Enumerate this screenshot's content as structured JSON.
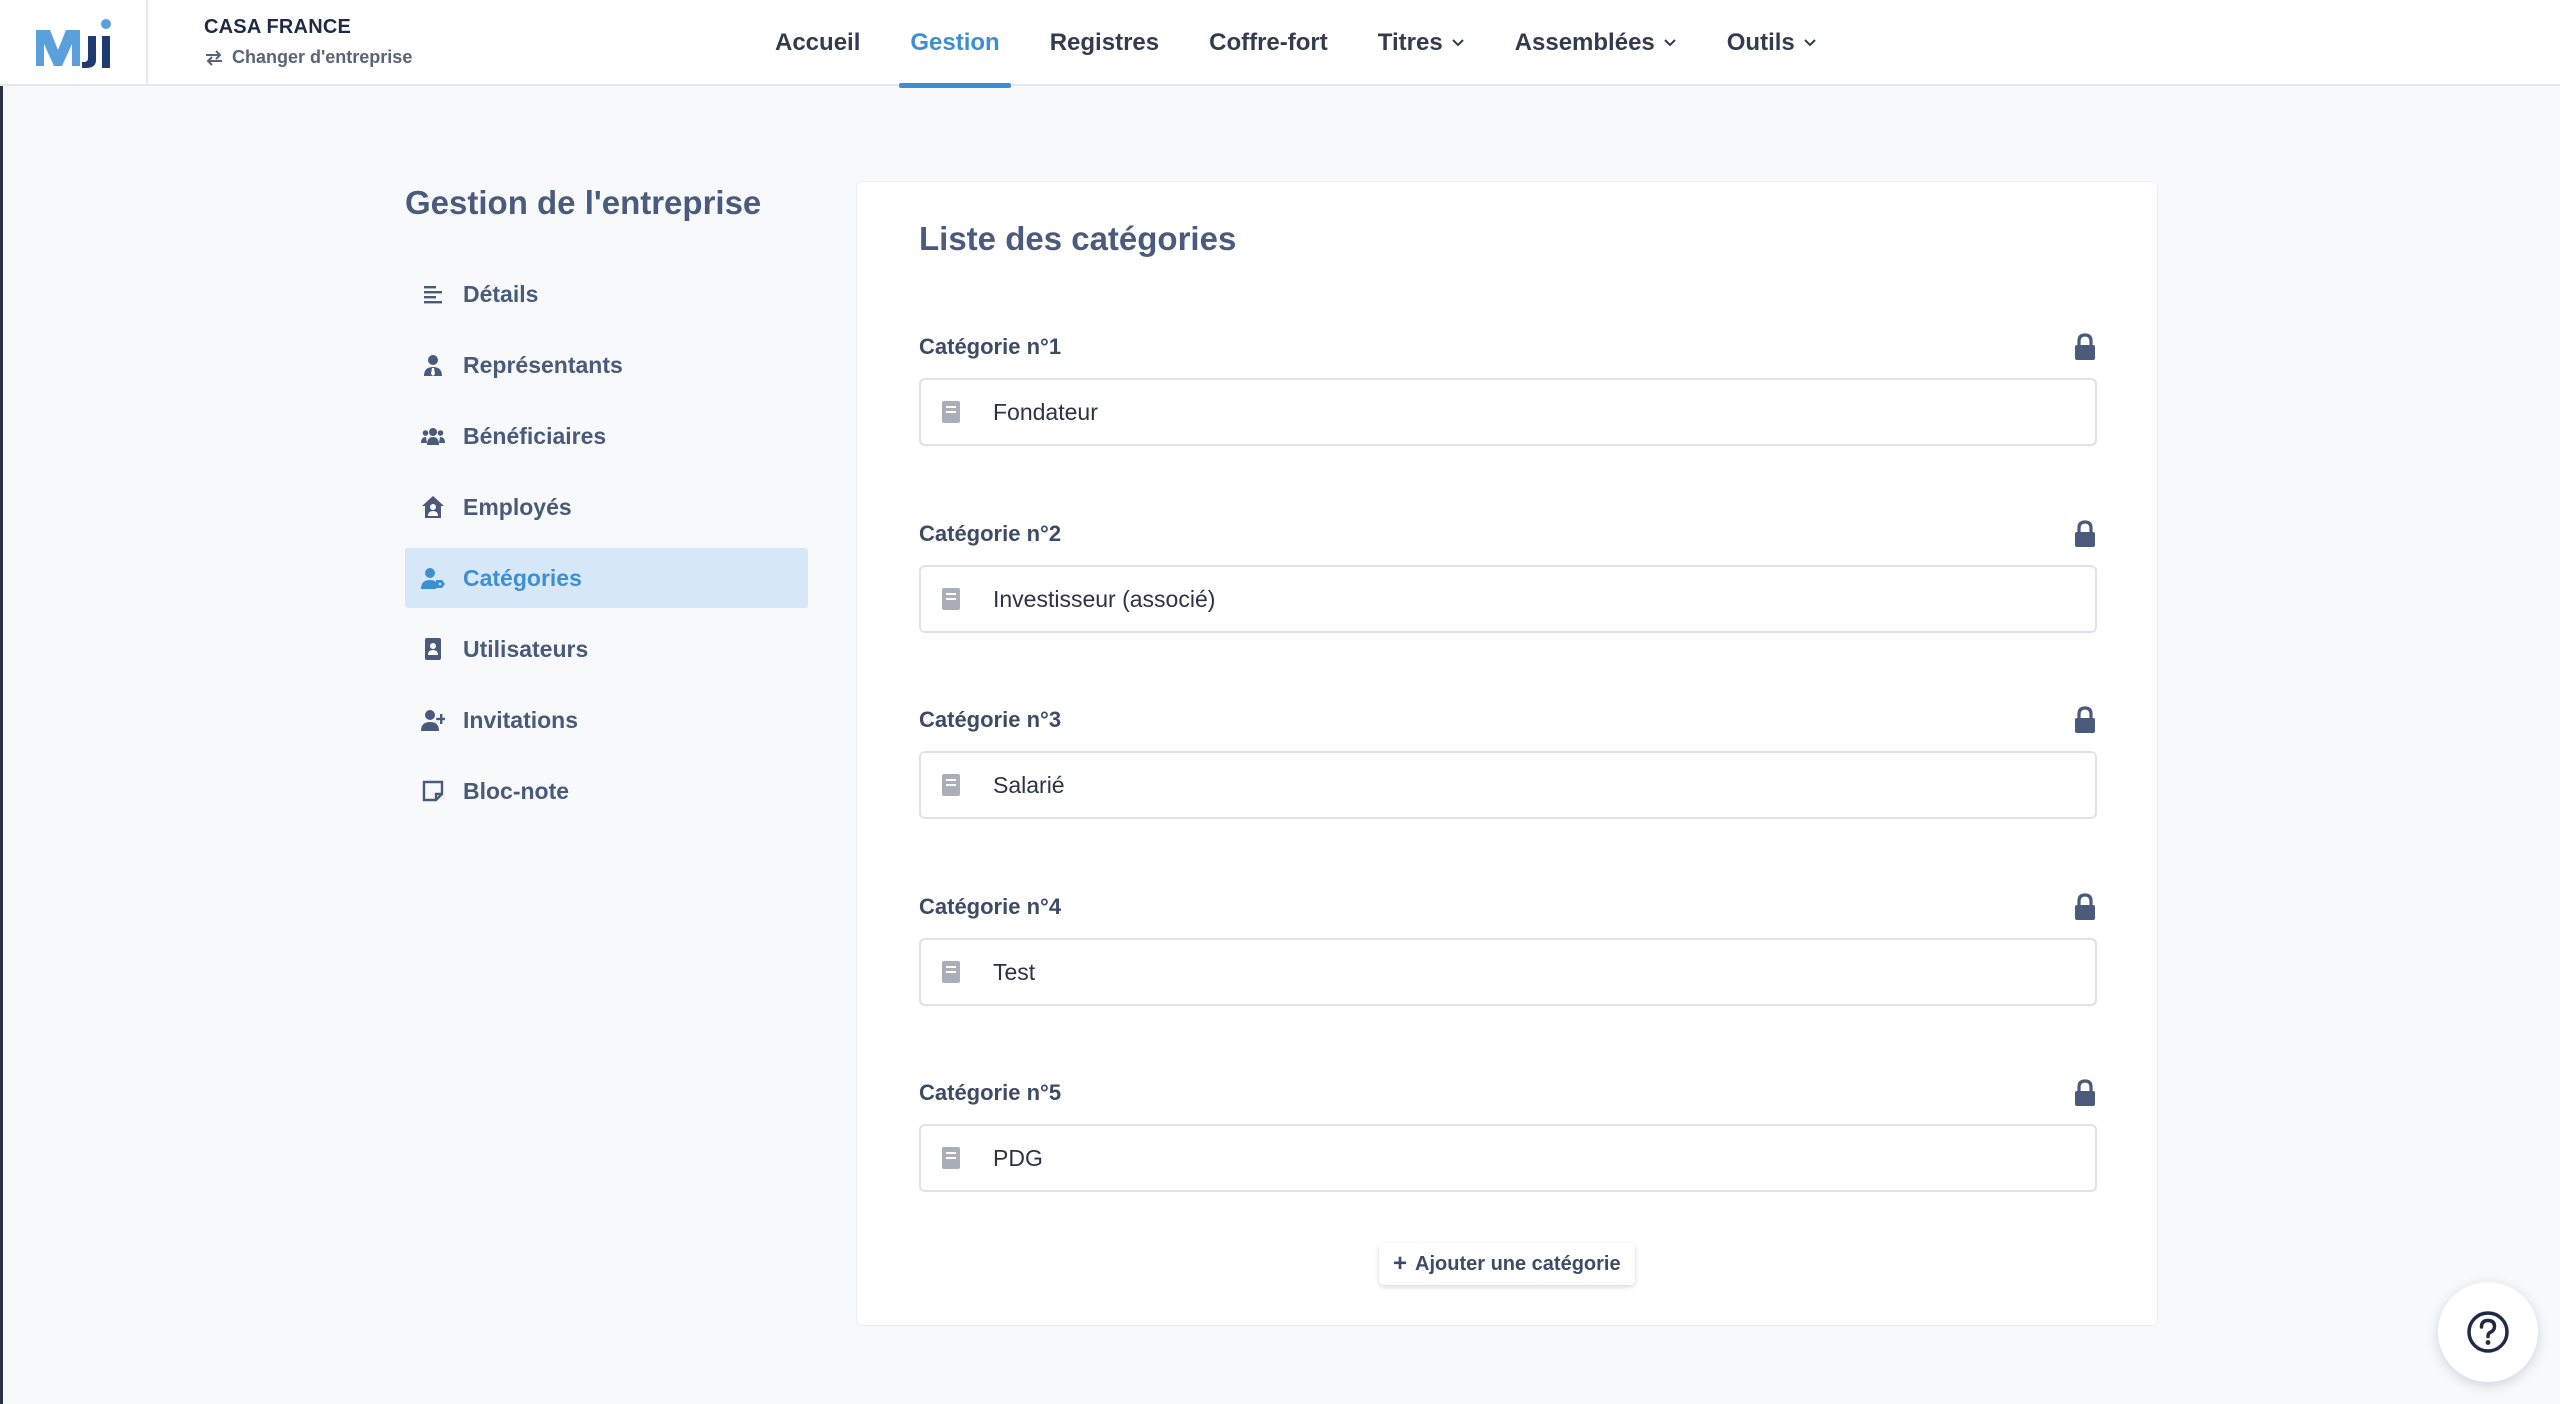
{
  "header": {
    "logo_text": "MJi",
    "company_name": "CASA FRANCE",
    "switch_label": "Changer d'entreprise",
    "nav": [
      {
        "label": "Accueil",
        "active": false,
        "dropdown": false
      },
      {
        "label": "Gestion",
        "active": true,
        "dropdown": false
      },
      {
        "label": "Registres",
        "active": false,
        "dropdown": false
      },
      {
        "label": "Coffre-fort",
        "active": false,
        "dropdown": false
      },
      {
        "label": "Titres",
        "active": false,
        "dropdown": true
      },
      {
        "label": "Assemblées",
        "active": false,
        "dropdown": true
      },
      {
        "label": "Outils",
        "active": false,
        "dropdown": true
      }
    ]
  },
  "sidebar": {
    "title": "Gestion de l'entreprise",
    "items": [
      {
        "label": "Détails",
        "icon": "align-left-icon",
        "active": false
      },
      {
        "label": "Représentants",
        "icon": "user-tie-icon",
        "active": false
      },
      {
        "label": "Bénéficiaires",
        "icon": "users-icon",
        "active": false
      },
      {
        "label": "Employés",
        "icon": "house-user-icon",
        "active": false
      },
      {
        "label": "Catégories",
        "icon": "user-tag-icon",
        "active": true
      },
      {
        "label": "Utilisateurs",
        "icon": "address-book-icon",
        "active": false
      },
      {
        "label": "Invitations",
        "icon": "user-plus-icon",
        "active": false
      },
      {
        "label": "Bloc-note",
        "icon": "sticky-note-icon",
        "active": false
      }
    ]
  },
  "main": {
    "title": "Liste des catégories",
    "categories": [
      {
        "label": "Catégorie n°1",
        "value": "Fondateur",
        "locked": true
      },
      {
        "label": "Catégorie n°2",
        "value": "Investisseur (associé)",
        "locked": true
      },
      {
        "label": "Catégorie n°3",
        "value": "Salarié",
        "locked": true
      },
      {
        "label": "Catégorie n°4",
        "value": "Test",
        "locked": true
      },
      {
        "label": "Catégorie n°5",
        "value": "PDG",
        "locked": true
      }
    ],
    "add_button_label": "Ajouter une catégorie",
    "add_button_icon": "+"
  },
  "colors": {
    "accent": "#3d8fd1",
    "text": "#4a5a7a",
    "active_bg": "#d6e8f7"
  }
}
